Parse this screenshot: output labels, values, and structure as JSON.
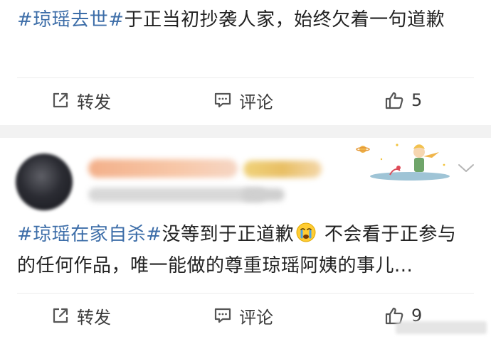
{
  "post1": {
    "hashtag": "#琼瑶去世#",
    "text": "于正当初抄袭人家，始终欠着一句道歉",
    "actions": {
      "repost": "转发",
      "comment": "评论",
      "like_count": "5"
    }
  },
  "post2": {
    "hashtag": "#琼瑶在家自杀#",
    "text_before_emoji": "没等到于正道歉",
    "emoji": "crying-face",
    "text_after_emoji": " 不会看于正参与的任何作品，唯一能做的尊重琼瑶阿姨的事儿...",
    "actions": {
      "repost": "转发",
      "comment": "评论",
      "like_count": "9"
    }
  },
  "colors": {
    "hashtag": "#3c6da8",
    "text": "#222222",
    "icon": "#555555",
    "separator": "#f2f2f2"
  }
}
